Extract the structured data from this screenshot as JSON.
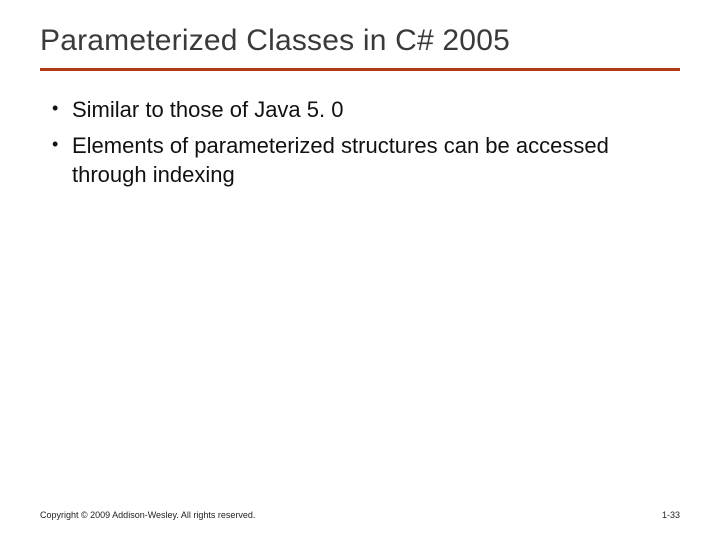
{
  "slide": {
    "title": "Parameterized Classes in C# 2005",
    "bullets": [
      "Similar to those of Java 5. 0",
      "Elements of parameterized structures can be accessed through indexing"
    ],
    "footer": {
      "copyright": "Copyright © 2009 Addison-Wesley. All rights reserved.",
      "page": "1-33"
    }
  }
}
